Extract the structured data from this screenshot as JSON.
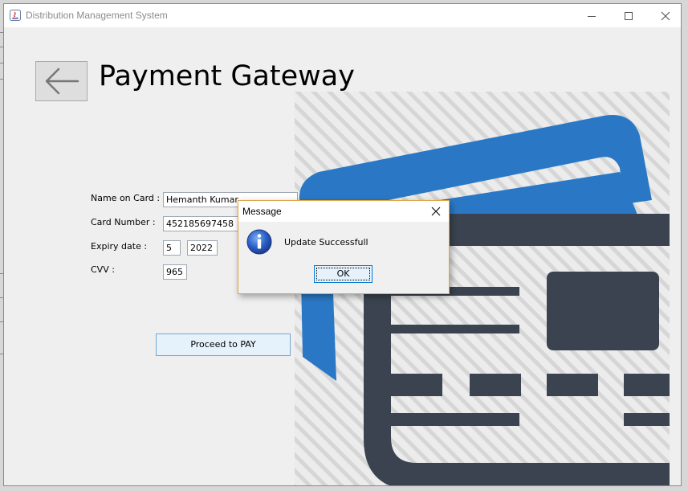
{
  "window": {
    "title": "Distribution Management System"
  },
  "page": {
    "title": "Payment Gateway"
  },
  "form": {
    "name_label": "Name on Card :",
    "name_value": "Hemanth Kumar",
    "card_label": "Card Number :",
    "card_value": "452185697458",
    "expiry_label": "Expiry date :",
    "expiry_month": "5",
    "expiry_year": "2022",
    "cvv_label": "CVV :",
    "cvv_value": "965",
    "pay_button": "Proceed to PAY"
  },
  "dialog": {
    "title": "Message",
    "message": "Update Successfull",
    "ok_label": "OK"
  },
  "colors": {
    "card_blue": "#2a78c5",
    "card_dark": "#3a434f",
    "dialog_border": "#e0a64a",
    "button_bg": "#e5f1fb"
  },
  "icons": {
    "back": "arrow-left-icon",
    "info": "info-icon",
    "close": "close-icon",
    "card_illustration": "credit-card-icon"
  }
}
